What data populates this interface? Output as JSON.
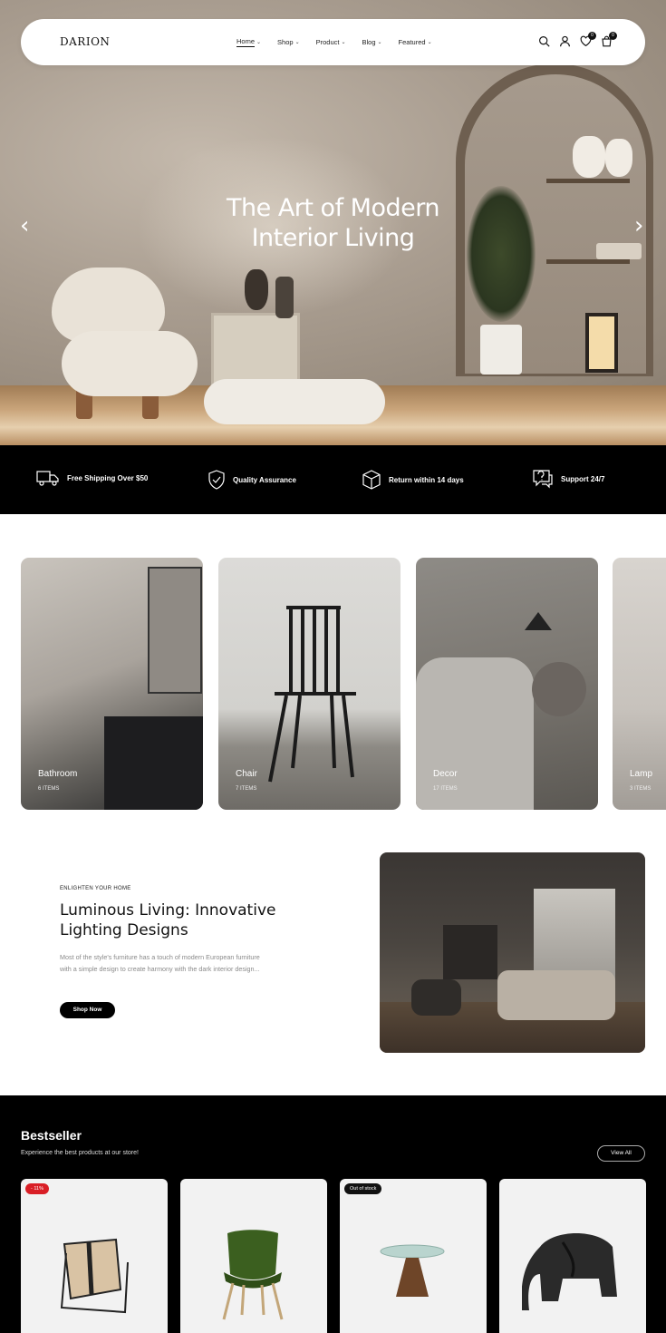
{
  "nav": {
    "logo": "DARION",
    "menu": [
      {
        "label": "Home",
        "active": true
      },
      {
        "label": "Shop"
      },
      {
        "label": "Product"
      },
      {
        "label": "Blog"
      },
      {
        "label": "Featured"
      }
    ],
    "icons": [
      "search-icon",
      "user-icon",
      "heart-icon",
      "cart-icon"
    ],
    "wishlist_count": "0",
    "cart_count": "0"
  },
  "hero": {
    "title_line1": "The Art of Modern",
    "title_line2": "Interior Living",
    "prev_arrow": "‹",
    "next_arrow": "›"
  },
  "features": [
    {
      "icon": "truck-icon",
      "label": "Free Shipping Over $50"
    },
    {
      "icon": "shield-check-icon",
      "label": "Quality Assurance"
    },
    {
      "icon": "box-icon",
      "label": "Return within 14 days"
    },
    {
      "icon": "support-chat-icon",
      "label": "Support 24/7"
    }
  ],
  "categories": [
    {
      "name": "Bathroom",
      "count": "6 ITEMS"
    },
    {
      "name": "Chair",
      "count": "7 ITEMS"
    },
    {
      "name": "Decor",
      "count": "17 ITEMS"
    },
    {
      "name": "Lamp",
      "count": "3 ITEMS"
    }
  ],
  "promo": {
    "eyebrow": "ENLIGHTEN YOUR HOME",
    "title": "Luminous Living: Innovative Lighting Designs",
    "text": "Most of the style's furniture has a touch of modern European furniture with a simple design to create harmony with the dark interior design...",
    "button": "Shop Now"
  },
  "bestseller": {
    "title": "Bestseller",
    "subtitle": "Experience the best products at our store!",
    "view_all": "View All",
    "products": [
      {
        "badge": "- 11%",
        "badge_color": "#d91f26"
      },
      {
        "badge": ""
      },
      {
        "badge": "Out of stock",
        "badge_color": "#111111"
      },
      {
        "badge": ""
      }
    ]
  }
}
